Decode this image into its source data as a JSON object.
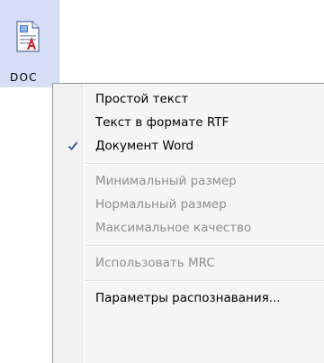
{
  "file_icon": {
    "label": "DOC",
    "icon": "word-document-icon"
  },
  "menu": {
    "items": [
      {
        "label": "Простой текст",
        "enabled": true,
        "checked": false
      },
      {
        "label": "Текст в формате RTF",
        "enabled": true,
        "checked": false
      },
      {
        "label": "Документ Word",
        "enabled": true,
        "checked": true
      },
      {
        "label": "Минимальный размер",
        "enabled": false,
        "checked": false
      },
      {
        "label": "Нормальный размер",
        "enabled": false,
        "checked": false
      },
      {
        "label": "Максимальное качество",
        "enabled": false,
        "checked": false
      },
      {
        "label": "Использовать MRC",
        "enabled": false,
        "checked": false
      },
      {
        "label": "Параметры распознавания...",
        "enabled": true,
        "checked": false
      }
    ],
    "check_icon": "checkmark-icon",
    "colors": {
      "enabled_text": "#000000",
      "disabled_text": "#8e8e8e",
      "check": "#2a4a9a",
      "selection_tile": "#d4dff7"
    }
  }
}
